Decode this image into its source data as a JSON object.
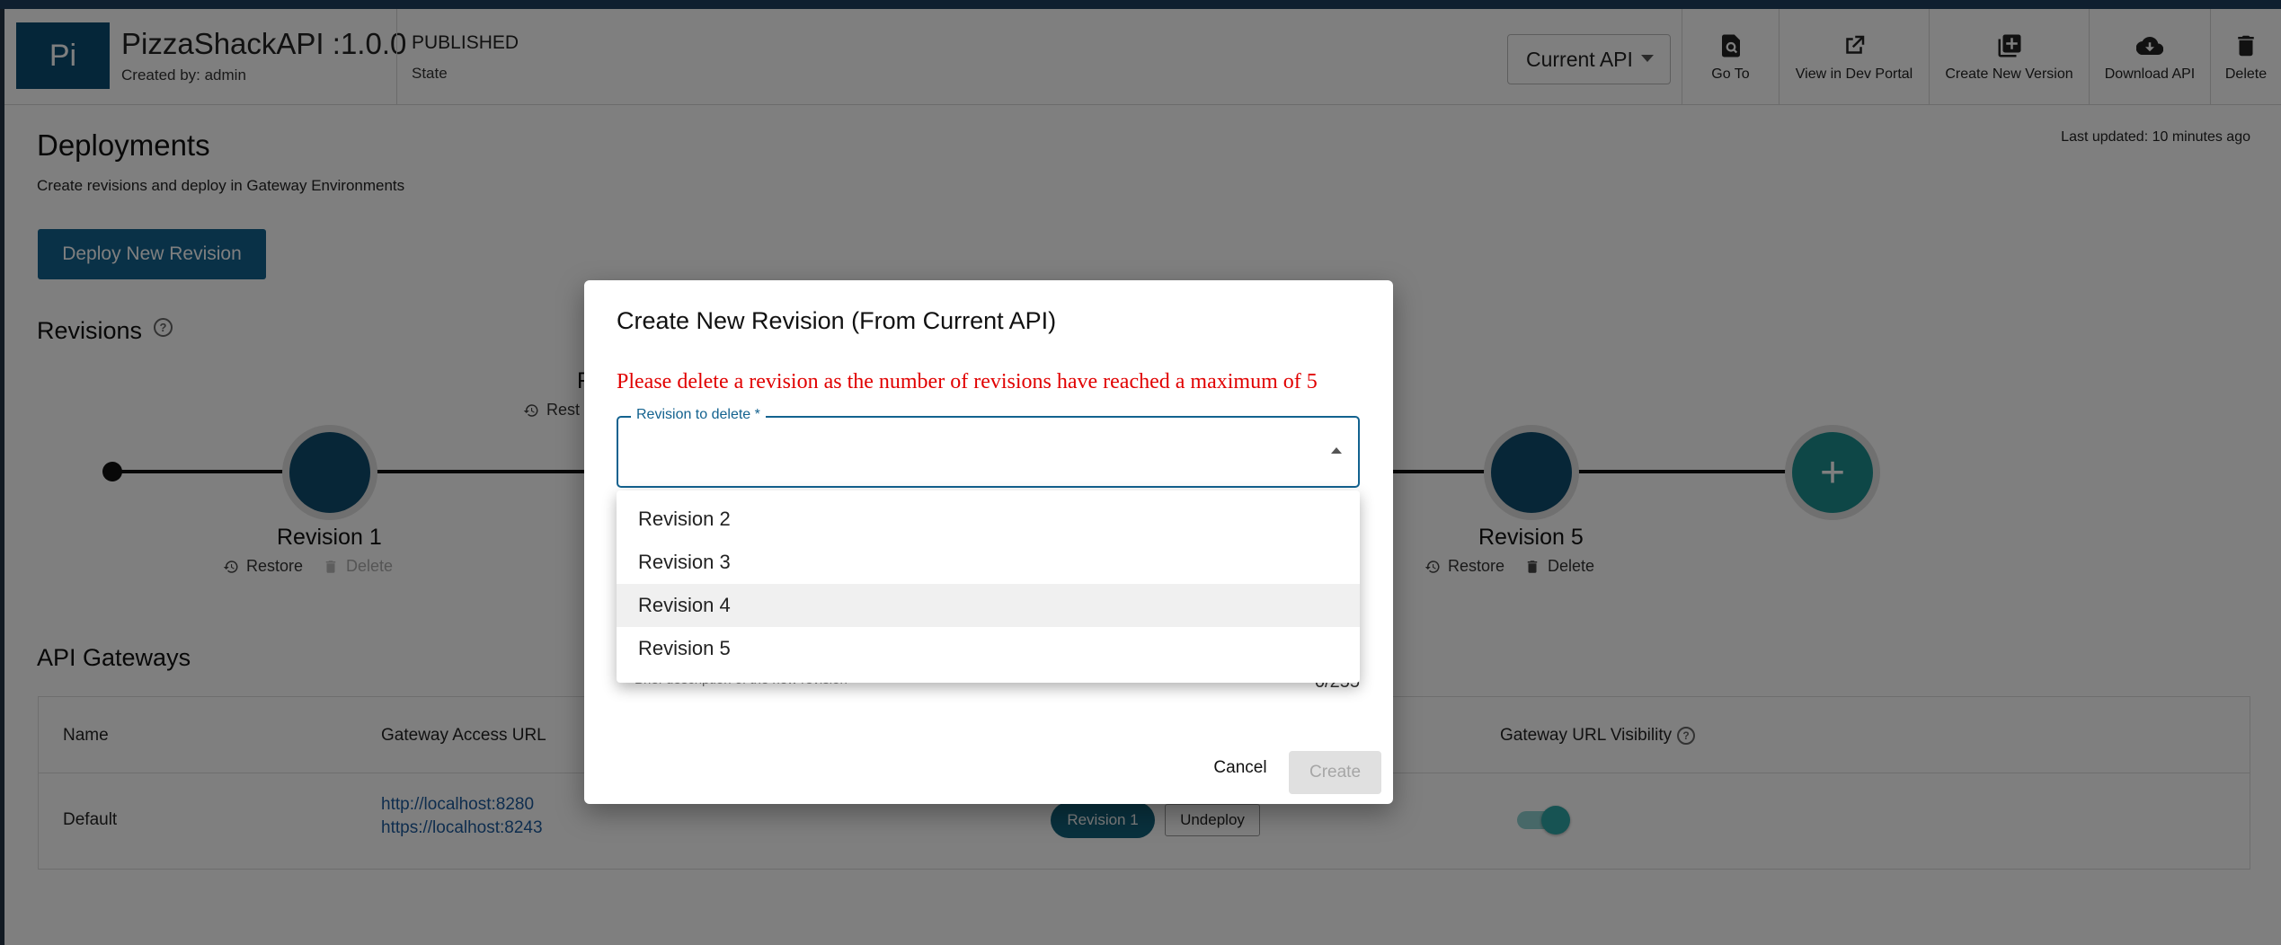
{
  "header": {
    "avatar_text": "Pi",
    "api_title": "PizzaShackAPI :1.0.0",
    "created_by": "Created by: admin",
    "state_value": "PUBLISHED",
    "state_label": "State",
    "api_selector": "Current API",
    "actions": {
      "go_to": "Go To",
      "view_dev_portal": "View in Dev Portal",
      "create_new_version": "Create New Version",
      "download_api": "Download API",
      "delete": "Delete"
    }
  },
  "deployments": {
    "title": "Deployments",
    "subtitle": "Create revisions and deploy in Gateway Environments",
    "last_updated": "Last updated: 10 minutes ago",
    "deploy_button": "Deploy New Revision"
  },
  "revisions": {
    "title": "Revisions",
    "help_glyph": "?",
    "hidden_label_fragment": "R",
    "hidden_restore_fragment": "Rest",
    "nodes": [
      {
        "label": "Revision 1",
        "restore": "Restore",
        "delete": "Delete"
      },
      {
        "label": "Revision 5",
        "restore": "Restore",
        "delete": "Delete"
      }
    ],
    "add_glyph": "+"
  },
  "gateways": {
    "title": "API Gateways",
    "columns": {
      "name": "Name",
      "access_url": "Gateway Access URL",
      "visibility": "Gateway URL Visibility"
    },
    "rows": [
      {
        "name": "Default",
        "http_url": "http://localhost:8280",
        "https_url": "https://localhost:8243",
        "revision_chip": "Revision 1",
        "undeploy": "Undeploy"
      }
    ]
  },
  "dialog": {
    "title": "Create New Revision (From Current API)",
    "error": "Please delete a revision as the number of revisions have reached a maximum of 5",
    "field_label": "Revision to delete *",
    "helper_text": "Brief description of the new revision",
    "char_count": "0/255",
    "cancel": "Cancel",
    "create": "Create",
    "options": [
      "Revision 2",
      "Revision 3",
      "Revision 4",
      "Revision 5"
    ],
    "highlighted_option": "Revision 4"
  },
  "colors": {
    "brand": "#13628f",
    "node": "#0f4c6e",
    "add_node": "#1d8f8f",
    "error": "#e10000",
    "link": "#1c5a9c"
  }
}
